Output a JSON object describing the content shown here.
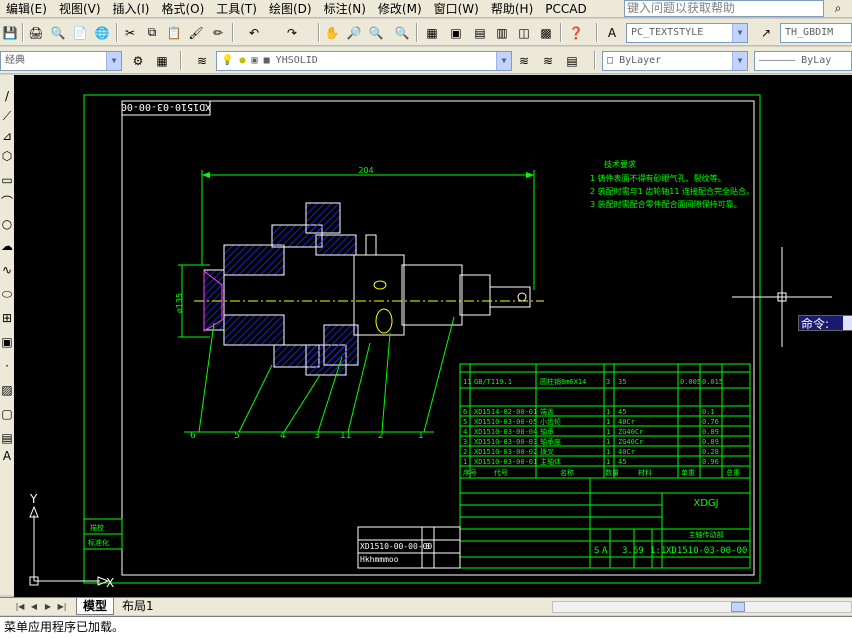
{
  "menubar": {
    "items": [
      "编辑(E)",
      "视图(V)",
      "插入(I)",
      "格式(O)",
      "工具(T)",
      "绘图(D)",
      "标注(N)",
      "修改(M)",
      "窗口(W)",
      "帮助(H)",
      "PCCAD"
    ],
    "help_placeholder": "键入问题以获取帮助"
  },
  "toolbar1": {
    "textstyle": "PC_TEXTSTYLE",
    "dimstyle": "TH_GBDIM"
  },
  "toolbar2": {
    "workspace": "经典",
    "layer": "YHSOLID",
    "color": "ByLayer",
    "linetype": "ByLay"
  },
  "drawing": {
    "drawing_number_box": "XD1510-03-00-00",
    "tech_req_title": "技术要求",
    "tech_req": [
      "1  铸件表面不得有砂眼气孔、裂纹等。",
      "2  装配时需与1 齿轮轴11 连接配合完全贴合。",
      "3  装配时需配合零件配合面间隙保持可靠。"
    ],
    "dim_width": "204",
    "dim_height": "ø135",
    "leaders": [
      "6",
      "5",
      "4",
      "3",
      "11",
      "2",
      "1"
    ],
    "bom_top": {
      "no": "11",
      "code": "GB/T119.1",
      "name": "圆柱销8m6X14",
      "qty": "3",
      "mat": "35",
      "w1": "0.005",
      "w2": "0.015"
    },
    "bom": [
      {
        "no": "6",
        "code": "XD1514-02-00-01",
        "name": "端盖",
        "qty": "1",
        "mat": "45",
        "wt": "0.1"
      },
      {
        "no": "5",
        "code": "XD1510-03-00-05",
        "name": "小齿轮",
        "qty": "1",
        "mat": "40Cr",
        "wt": "0.76"
      },
      {
        "no": "4",
        "code": "XD1510-03-00-04",
        "name": "轴承",
        "qty": "1",
        "mat": "ZG40Cr",
        "wt": "0.89"
      },
      {
        "no": "3",
        "code": "XD1510-03-00-03",
        "name": "轴承座",
        "qty": "1",
        "mat": "ZG40Cr",
        "wt": "0.89"
      },
      {
        "no": "2",
        "code": "XD1510-03-00-02",
        "name": "拨叉",
        "qty": "1",
        "mat": "40Cr",
        "wt": "0.28"
      },
      {
        "no": "1",
        "code": "XD1510-03-00-01",
        "name": "主轴体",
        "qty": "1",
        "mat": "45",
        "wt": "0.96"
      }
    ],
    "bom_header": [
      "序号",
      "代号",
      "名称",
      "数量",
      "材料",
      "单重",
      "总重"
    ],
    "title_company": "XDGJ",
    "title_name": "主轴传动部",
    "title_number": "XD1510-03-00-00",
    "title_scale": "1:1",
    "title_weight": "3.69",
    "title_sheet": "S",
    "title_stage": "A",
    "side_labels": [
      "描校",
      "标准化"
    ],
    "lower_ref": "XD1510-00-00-00",
    "lower_ref_sub": "Hkhmmmoo",
    "lower_qty": "3",
    "axis_x": "X",
    "axis_y": "Y"
  },
  "tabs": {
    "model": "模型",
    "layout1": "布局1"
  },
  "command": {
    "prompt": "命令:",
    "history": "菜单应用程序已加载。"
  },
  "colors": {
    "draw_green": "#00ff00",
    "draw_white": "#ffffff",
    "draw_blue": "#1010ff",
    "draw_yellow": "#ffff00"
  }
}
